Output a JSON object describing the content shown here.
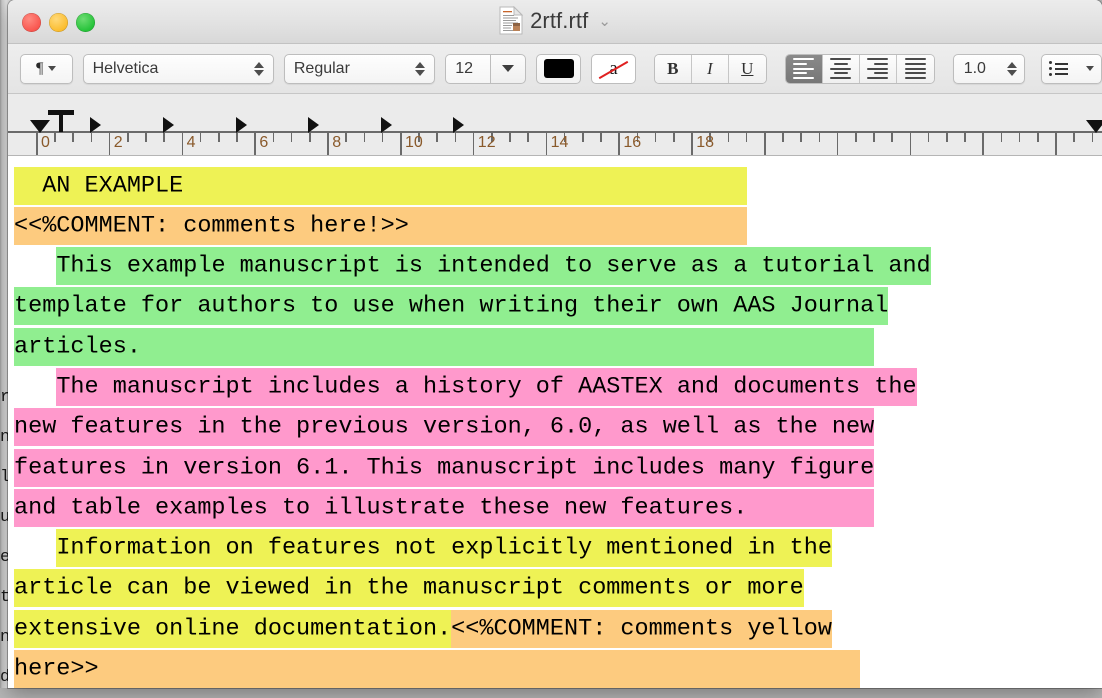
{
  "window": {
    "traffic_lights": [
      {
        "name": "close",
        "color": "#f9564f"
      },
      {
        "name": "minimize",
        "color": "#fbbd2f"
      },
      {
        "name": "maximize",
        "color": "#26c33a"
      }
    ],
    "title": "2rtf.rtf",
    "title_chevron": "⌄"
  },
  "toolbar": {
    "paragraph_style": "¶",
    "font_family": "Helvetica",
    "font_style": "Regular",
    "font_size": "12",
    "text_color": "#000000",
    "highlight_letter": "a",
    "highlight_slash_color": "#e02020",
    "bold": "B",
    "italic": "I",
    "underline": "U",
    "align_options": [
      "align-left",
      "align-center",
      "align-right",
      "align-justify"
    ],
    "align_selected": "align-left",
    "line_spacing": "1.0",
    "list_label": "list"
  },
  "ruler": {
    "unit_labels": [
      "0",
      "2",
      "4",
      "6",
      "8",
      "10",
      "12",
      "14",
      "16",
      "18"
    ],
    "tab_markers": 7,
    "left_indent": "0",
    "tab_stop": "0.6"
  },
  "document": {
    "paragraphs": [
      {
        "name": "heading-an-example",
        "lines": [
          [
            {
              "text": "  AN EXAMPLE                                        ",
              "hl": "y"
            }
          ]
        ]
      },
      {
        "name": "comment-1",
        "lines": [
          [
            {
              "text": "<<%COMMENT: comments here!>>                        ",
              "hl": "o"
            }
          ]
        ]
      },
      {
        "name": "paragraph-green",
        "lines": [
          [
            {
              "text": "   ",
              "hl": "none"
            },
            {
              "text": "This example manuscript is intended to serve as a tutorial and",
              "hl": "g"
            }
          ],
          [
            {
              "text": "template for authors to use when writing their own AAS Journal",
              "hl": "g"
            }
          ],
          [
            {
              "text": "articles.                                                    ",
              "hl": "g"
            }
          ]
        ]
      },
      {
        "name": "paragraph-pink",
        "lines": [
          [
            {
              "text": "   ",
              "hl": "none"
            },
            {
              "text": "The manuscript includes a history of AASTEX and documents the",
              "hl": "p"
            }
          ],
          [
            {
              "text": "new features in the previous version, 6.0, as well as the new",
              "hl": "p"
            }
          ],
          [
            {
              "text": "features in version 6.1. This manuscript includes many figure",
              "hl": "p"
            }
          ],
          [
            {
              "text": "and table examples to illustrate these new features.         ",
              "hl": "p"
            }
          ]
        ]
      },
      {
        "name": "paragraph-yellow",
        "lines": [
          [
            {
              "text": "   ",
              "hl": "none"
            },
            {
              "text": "Information on features not explicitly mentioned in the",
              "hl": "y"
            }
          ],
          [
            {
              "text": "article can be viewed in the manuscript comments or more",
              "hl": "y"
            }
          ],
          [
            {
              "text": "extensive online documentation.",
              "hl": "y"
            },
            {
              "text": "<<%COMMENT: comments yellow",
              "hl": "o"
            }
          ],
          [
            {
              "text": "here>>                                                      ",
              "hl": "o"
            }
          ]
        ]
      }
    ],
    "highlight_colors": {
      "yellow": "#eef255",
      "orange": "#fdcb7f",
      "green": "#90ee90",
      "pink": "#ff99cc"
    }
  },
  "background_window": {
    "visible_chars": [
      "r",
      "n",
      "l",
      "u",
      "e",
      "t",
      "n",
      "d"
    ]
  }
}
